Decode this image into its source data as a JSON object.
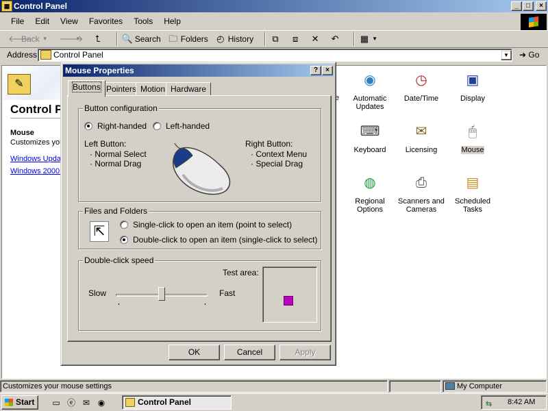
{
  "window": {
    "title": "Control Panel",
    "controls": {
      "minimize": "_",
      "maximize": "□",
      "close": "×"
    }
  },
  "menu": [
    "File",
    "Edit",
    "View",
    "Favorites",
    "Tools",
    "Help"
  ],
  "toolbar": {
    "back": "Back",
    "search": "Search",
    "folders": "Folders",
    "history": "History"
  },
  "address": {
    "label": "Address",
    "value": "Control Panel",
    "go": "Go"
  },
  "panel": {
    "heading": "Control P",
    "selected_name": "Mouse",
    "selected_desc": "Customizes you",
    "links": [
      "Windows Updat",
      "Windows 2000 S"
    ],
    "partial_label": "e"
  },
  "icons": [
    {
      "label": "Automatic\nUpdates",
      "icon": "globe-update-icon",
      "color": "#2f7fc0",
      "glyph": "◉"
    },
    {
      "label": "Date/Time",
      "icon": "calendar-clock-icon",
      "color": "#f0f0f0",
      "glyph": "◷"
    },
    {
      "label": "Display",
      "icon": "monitor-icon",
      "color": "#2040a0",
      "glyph": "▣"
    },
    {
      "label": "Keyboard",
      "icon": "keyboard-icon",
      "color": "#e8e8e8",
      "glyph": "⌨"
    },
    {
      "label": "Licensing",
      "icon": "certificate-icon",
      "color": "#f0f0e0",
      "glyph": "✉"
    },
    {
      "label": "Mouse",
      "icon": "mouse-icon",
      "color": "#f4f4f4",
      "glyph": "🖱"
    },
    {
      "label": "Regional\nOptions",
      "icon": "globe-icon",
      "color": "#20a040",
      "glyph": "◍"
    },
    {
      "label": "Scanners and\nCameras",
      "icon": "scanner-icon",
      "color": "#c0c0c0",
      "glyph": "⎙"
    },
    {
      "label": "Scheduled\nTasks",
      "icon": "scheduled-folder-icon",
      "color": "#f0d060",
      "glyph": "▤"
    }
  ],
  "status": {
    "text": "Customizes your mouse settings",
    "zone": "My Computer"
  },
  "taskbar": {
    "start": "Start",
    "task": "Control Panel",
    "clock": "8:42 AM"
  },
  "dialog": {
    "title": "Mouse Properties",
    "tabs": [
      "Buttons",
      "Pointers",
      "Motion",
      "Hardware"
    ],
    "button_config": {
      "label": "Button configuration",
      "right_handed": "Right-handed",
      "left_handed": "Left-handed",
      "selected": "right",
      "left_button_title": "Left Button:",
      "left_button_items": [
        "· Normal Select",
        "· Normal Drag"
      ],
      "right_button_title": "Right Button:",
      "right_button_items": [
        "· Context Menu",
        "· Special Drag"
      ]
    },
    "files_folders": {
      "label": "Files and Folders",
      "single": "Single-click to open an item (point to select)",
      "double": "Double-click to open an item (single-click to select)",
      "selected": "double"
    },
    "double_click": {
      "label": "Double-click speed",
      "test_area": "Test area:",
      "slow": "Slow",
      "fast": "Fast",
      "speed_fraction": 0.5
    },
    "buttons": {
      "ok": "OK",
      "cancel": "Cancel",
      "apply": "Apply"
    }
  }
}
